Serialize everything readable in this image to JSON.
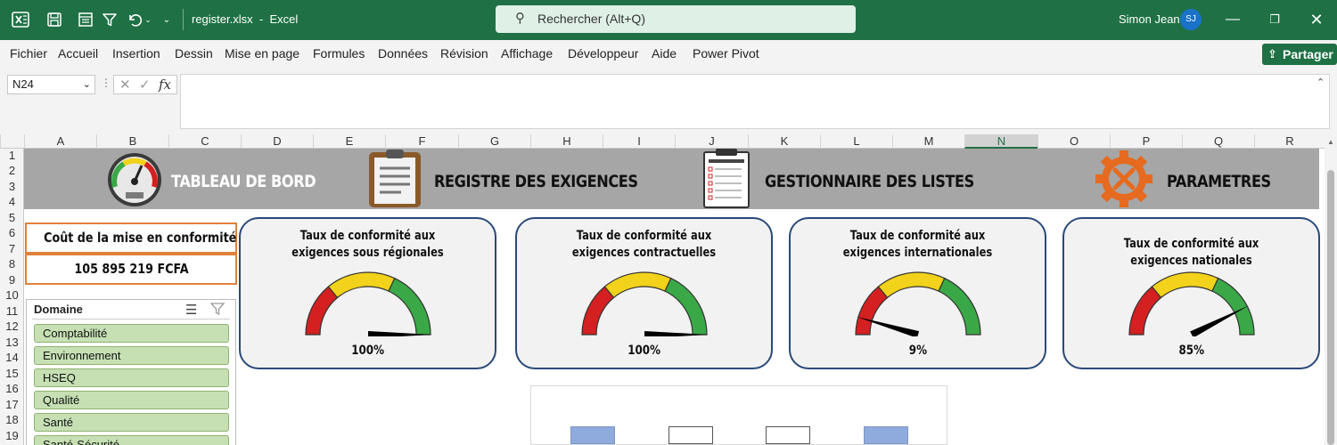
{
  "titlebar": {
    "filename": "register.xlsx",
    "app": "Excel",
    "separator": "-",
    "search_placeholder": "Rechercher (Alt+Q)",
    "user_name": "Simon Jean",
    "user_initials": "SJ"
  },
  "menu": [
    "Fichier",
    "Accueil",
    "Insertion",
    "Dessin",
    "Mise en page",
    "Formules",
    "Données",
    "Révision",
    "Affichage",
    "Développeur",
    "Aide",
    "Power Pivot"
  ],
  "share_label": "Partager",
  "formula_bar": {
    "name_box": "N24",
    "fx": "fx",
    "value": ""
  },
  "columns": [
    "A",
    "B",
    "C",
    "D",
    "E",
    "F",
    "G",
    "H",
    "I",
    "J",
    "K",
    "L",
    "M",
    "N",
    "O",
    "P",
    "Q",
    "R"
  ],
  "active_column": "N",
  "rows": [
    "1",
    "2",
    "3",
    "4",
    "5",
    "6",
    "7",
    "8",
    "9",
    "10",
    "11",
    "12",
    "13",
    "14",
    "15",
    "16",
    "17",
    "18",
    "19"
  ],
  "nav": {
    "dashboard": "TABLEAU DE BORD",
    "register": "REGISTRE DES EXIGENCES",
    "lists": "GESTIONNAIRE DES LISTES",
    "settings": "PARAMETRES"
  },
  "cost": {
    "label": "Coût de la mise en conformité",
    "value": "105 895 219 FCFA"
  },
  "slicer": {
    "title": "Domaine",
    "items": [
      "Comptabilité",
      "Environnement",
      "HSEQ",
      "Qualité",
      "Santé",
      "Santé-Sécurité"
    ]
  },
  "gauges": [
    {
      "title": "Taux de conformité aux exigences sous régionales",
      "value_label": "100%",
      "value": 1.0
    },
    {
      "title": "Taux de conformité aux exigences contractuelles",
      "value_label": "100%",
      "value": 1.0
    },
    {
      "title": "Taux de conformité aux exigences internationales",
      "value_label": "9%",
      "value": 0.09
    },
    {
      "title": "Taux de conformité aux exigences nationales",
      "value_label": "85%",
      "value": 0.85
    }
  ],
  "colors": {
    "excel_green": "#1f7145",
    "banner_gray": "#a6a6a6",
    "card_border": "#2a4a7a",
    "cost_border": "#e0813a",
    "slicer_item": "#c6e0b4",
    "gauge_red": "#d42020",
    "gauge_yellow": "#f2d21a",
    "gauge_green": "#3aa846"
  }
}
